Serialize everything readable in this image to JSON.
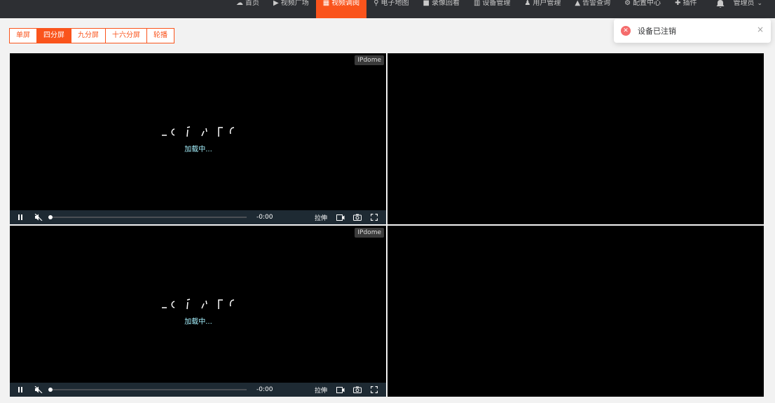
{
  "nav": {
    "items": [
      {
        "label": "首页",
        "icon": "cloud-icon"
      },
      {
        "label": "视频广场",
        "icon": "play-icon"
      },
      {
        "label": "视频调阅",
        "icon": "grid-icon",
        "active": true
      },
      {
        "label": "电子地图",
        "icon": "map-pin-icon"
      },
      {
        "label": "录像回看",
        "icon": "video-camera-icon"
      },
      {
        "label": "设备管理",
        "icon": "server-icon"
      },
      {
        "label": "用户管理",
        "icon": "user-icon"
      },
      {
        "label": "告警查询",
        "icon": "alarm-icon"
      },
      {
        "label": "配置中心",
        "icon": "gear-icon"
      },
      {
        "label": "插件",
        "icon": "puzzle-icon"
      }
    ],
    "user": "管理员"
  },
  "split": {
    "buttons": [
      "单屏",
      "四分屏",
      "九分屏",
      "十六分屏",
      "轮播"
    ],
    "active_index": 1
  },
  "toast": {
    "message": "设备已注销"
  },
  "players": [
    {
      "tag": "IPdome",
      "loading": "加载中...",
      "time": "-0:00",
      "stretch": "拉伸"
    },
    {
      "tag": "IPdome",
      "loading": "加载中...",
      "time": "-0:00",
      "stretch": "拉伸"
    }
  ],
  "colors": {
    "accent": "#fa541c",
    "topbar": "#2d2f33",
    "error": "#f56c6c",
    "loading": "#a6f2ff"
  }
}
